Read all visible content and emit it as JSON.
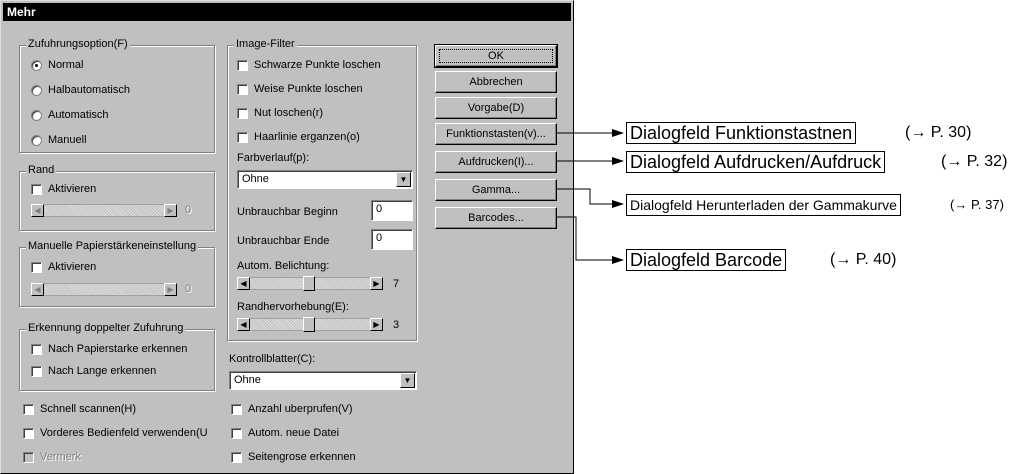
{
  "dialog": {
    "title": "Mehr",
    "feed_option": {
      "legend": "Zufuhrungsoption(F)",
      "options": [
        "Normal",
        "Halbautomatisch",
        "Automatisch",
        "Manuell"
      ],
      "selected": "Normal"
    },
    "edge": {
      "legend": "Rand",
      "activate": "Aktivieren",
      "slider_value": "0"
    },
    "manual_paper": {
      "legend": "Manuelle Papierstärkeneinstellung",
      "activate": "Aktivieren",
      "slider_value": "0"
    },
    "double_feed": {
      "legend": "Erkennung doppelter Zufuhrung",
      "by_thickness": "Nach Papierstarke erkennen",
      "by_length": "Nach Lange erkennen"
    },
    "image_filter": {
      "legend": "Image-Filter",
      "black_points": "Schwarze Punkte loschen",
      "white_points": "Weise Punkte loschen",
      "groove": "Nut loschen(r)",
      "hairline": "Haarlinie erganzen(o)",
      "gradient_label": "Farbverlauf(p):",
      "gradient_value": "Ohne",
      "unusable_start_label": "Unbrauchbar Beginn",
      "unusable_start_value": "0",
      "unusable_end_label": "Unbrauchbar Ende",
      "unusable_end_value": "0",
      "auto_exposure_label": "Autom. Belichtung:",
      "auto_exposure_value": "7",
      "edge_emphasis_label": "Randhervorhebung(E):",
      "edge_emphasis_value": "3"
    },
    "control_sheet_label": "Kontrollblatter(C):",
    "control_sheet_value": "Ohne",
    "bottom_left": {
      "quick_scan": "Schnell scannen(H)",
      "front_panel": "Vorderes Bedienfeld verwenden(U",
      "note": "Vermerk"
    },
    "bottom_right": {
      "check_count": "Anzahl uberprufen(V)",
      "auto_new_file": "Autom. neue Datei",
      "page_size": "Seitengrose erkennen"
    },
    "buttons": {
      "ok": "OK",
      "cancel": "Abbrechen",
      "default": "Vorgabe(D)",
      "function_keys": "Funktionstasten(v)...",
      "imprint": "Aufdrucken(I)...",
      "gamma": "Gamma...",
      "barcodes": "Barcodes..."
    }
  },
  "annotations": [
    {
      "label": "Dialogfeld Funktionstastnen",
      "ref": "(→ P. 30)"
    },
    {
      "label": "Dialogfeld Aufdrucken/Aufdruck",
      "ref": "(→ P. 32)"
    },
    {
      "label": "Dialogfeld Herunterladen der Gammakurve",
      "ref": "(→ P. 37)"
    },
    {
      "label": "Dialogfeld Barcode",
      "ref": "(→ P. 40)"
    }
  ]
}
